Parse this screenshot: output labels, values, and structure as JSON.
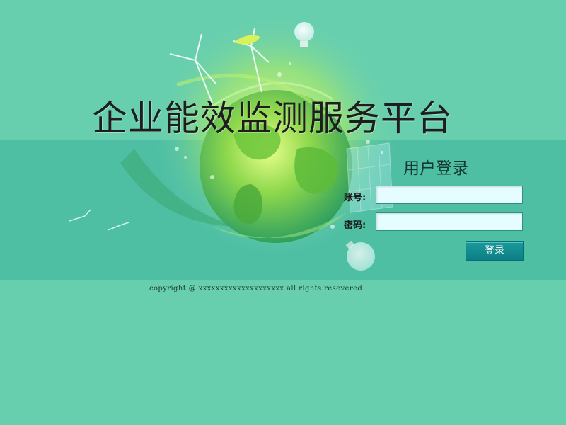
{
  "header": {
    "title": "企业能效监测服务平台"
  },
  "login": {
    "heading": "用户登录",
    "account_label": "账号:",
    "account_value": "",
    "password_label": "密码:",
    "password_value": "",
    "submit_label": "登录"
  },
  "footer": {
    "copyright": "copyright @ xxxxxxxxxxxxxxxxxxxx all rights resevered"
  },
  "decoration": {
    "globe_icon": "earth-globe-icon",
    "wind_turbine_icon": "wind-turbine-icon",
    "light_bulb_icon": "light-bulb-icon",
    "leaf_icon": "leaf-icon"
  },
  "colors": {
    "background": "#68cfae",
    "band": "#4fbfa4",
    "button": "#0c7f86",
    "input_bg": "#e6fdff"
  }
}
